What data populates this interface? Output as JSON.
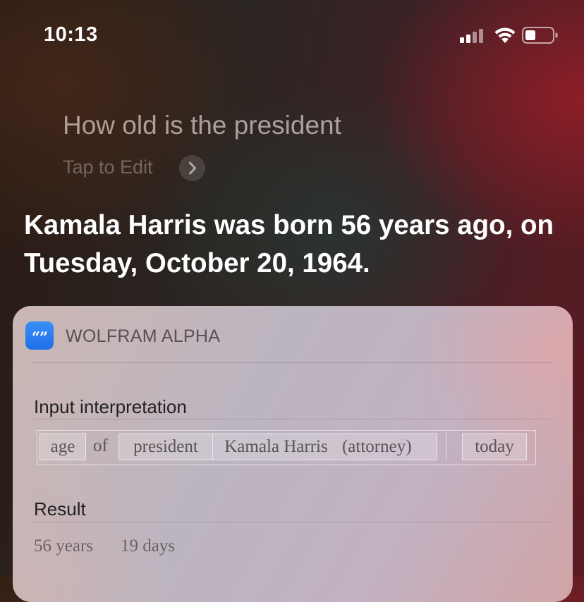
{
  "status_bar": {
    "time": "10:13",
    "icons": [
      "cellular-signal-icon",
      "wifi-icon",
      "battery-icon"
    ]
  },
  "siri": {
    "query": "How old is the president",
    "tap_to_edit": "Tap to Edit",
    "answer": "Kamala Harris was born 56 years ago, on Tuesday, October 20, 1964."
  },
  "card": {
    "source_icon": "wolfram-quote-icon",
    "source_icon_glyph": "“”",
    "source_title": "WOLFRAM ALPHA",
    "input_interpretation": {
      "label": "Input interpretation",
      "tokens": {
        "age": "age",
        "of": "of",
        "president": "president",
        "person": "Kamala Harris",
        "descriptor": "(attorney)",
        "today": "today"
      }
    },
    "result": {
      "label": "Result",
      "years": "56 years",
      "days": "19 days"
    }
  },
  "colors": {
    "accent_icon": "#2d7ff2",
    "text_primary": "#ffffff"
  }
}
